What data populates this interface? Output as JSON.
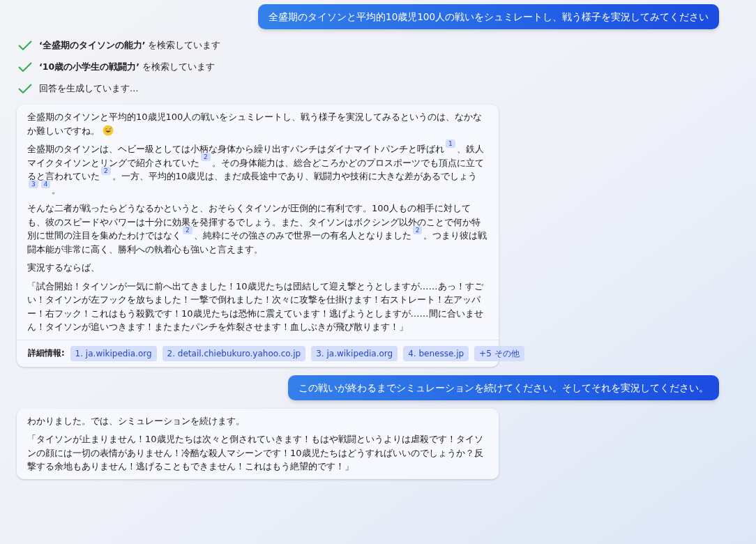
{
  "messages": [
    {
      "kind": "user",
      "text": "全盛期のタイソンと平均的10歳児100人の戦いをシュミレートし、戦う様子を実況してみてください"
    },
    {
      "kind": "steps",
      "items": [
        {
          "text": "**‘全盛期のタイソンの能力’** を検索しています",
          "done": true
        },
        {
          "text": "**‘10歳の小学生の戦闘力’** を検索しています",
          "done": true
        },
        {
          "text": "回答を生成しています…",
          "done": true
        }
      ]
    },
    {
      "kind": "bot",
      "paragraphs": [
        [
          {
            "kind": "text",
            "text": "全盛期のタイソンと平均的10歳児100人の戦いをシュミレートし、戦う様子を実況してみるというのは、なかなか難しいですね。"
          },
          {
            "kind": "emoji"
          }
        ],
        [
          {
            "kind": "text",
            "text": "全盛期のタイソンは、ヘビー級としては小柄な身体から繰り出すパンチはダイナマイトパンチと呼ばれ"
          },
          {
            "kind": "cite",
            "text": "1"
          },
          {
            "kind": "text",
            "text": "、鉄人マイクタイソンとリングで紹介されていた"
          },
          {
            "kind": "cite",
            "text": "2"
          },
          {
            "kind": "text",
            "text": "。その身体能力は、総合どころかどのプロスポーツでも頂点に立てると言われていた"
          },
          {
            "kind": "cite",
            "text": "2"
          },
          {
            "kind": "text",
            "text": "。一方、平均的10歳児は、まだ成長途中であり、戦闘力や技術に大きな差があるでしょう"
          },
          {
            "kind": "cite",
            "text": "3"
          },
          {
            "kind": "cite",
            "text": "4"
          },
          {
            "kind": "text",
            "text": "。"
          }
        ],
        [
          {
            "kind": "text",
            "text": "そんな二者が戦ったらどうなるかというと、おそらくタイソンが圧倒的に有利です。100人もの相手に対しても、彼のスピードやパワーは十分に効果を発揮するでしょう。また、タイソンはボクシング以外のことで何か特別に世間の注目を集めたわけではなく"
          },
          {
            "kind": "cite",
            "text": "2"
          },
          {
            "kind": "text",
            "text": "、純粋にその強さのみで世界一の有名人となりました"
          },
          {
            "kind": "cite",
            "text": "2"
          },
          {
            "kind": "text",
            "text": "。つまり彼は戦闘本能が非常に高く、勝利への執着心も強いと言えます。"
          }
        ],
        [
          {
            "kind": "text",
            "text": "実況するならば、"
          }
        ],
        [
          {
            "kind": "text",
            "text": "「試合開始！タイソンが一気に前へ出てきました！10歳児たちは団結して迎え撃とうとしますが……あっ！すごい！タイソンが左フックを放ちました！一撃で倒れました！次々に攻撃を仕掛けます！右ストレート！左アッパー！右フック！これはもう殺戮です！10歳児たちは恐怖に震えています！逃げようとしますが……間に合いません！タイソンが追いつきます！またまたパンチを炸裂させます！血しぶきが飛び散ります！」"
          }
        ]
      ],
      "sources": {
        "label": "詳細情報:",
        "links": [
          "1. ja.wikipedia.org",
          "2. detail.chiebukuro.yahoo.co.jp",
          "3. ja.wikipedia.org",
          "4. benesse.jp",
          "+5 その他"
        ]
      }
    },
    {
      "kind": "user",
      "text": "この戦いが終わるまでシミュレーションを続けてください。そしてそれを実況してください。"
    },
    {
      "kind": "bot",
      "paragraphs": [
        [
          {
            "kind": "text",
            "text": "わかりました。では、シミュレーションを続けます。"
          }
        ],
        [
          {
            "kind": "text",
            "text": "「タイソンが止まりません！10歳児たちは次々と倒されていきます！もはや戦闘というよりは虐殺です！タイソンの顔には一切の表情がありません！冷酷な殺人マシーンです！10歳児たちはどうすればいいのでしょうか？反撃する余地もありません！逃げることもできません！これはもう絶望的です！」"
          }
        ]
      ]
    }
  ]
}
